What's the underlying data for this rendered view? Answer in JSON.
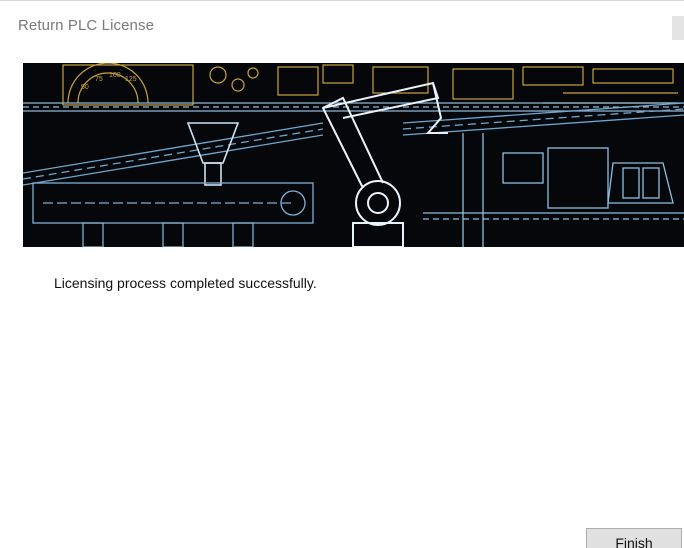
{
  "window": {
    "title": "Return PLC License"
  },
  "banner": {
    "image": "industrial-factory-line-blueprint",
    "gauge_labels": [
      "75",
      "100",
      "125",
      "50"
    ]
  },
  "main": {
    "message": "Licensing process completed successfully."
  },
  "footer": {
    "finish_label": "Finish"
  },
  "colors": {
    "banner_background": "#05070a",
    "blueprint_line": "#5fa3d6",
    "blueprint_accent": "#c9a23a",
    "button_face": "#e1e1e1",
    "title_text": "#7a7a7a"
  }
}
